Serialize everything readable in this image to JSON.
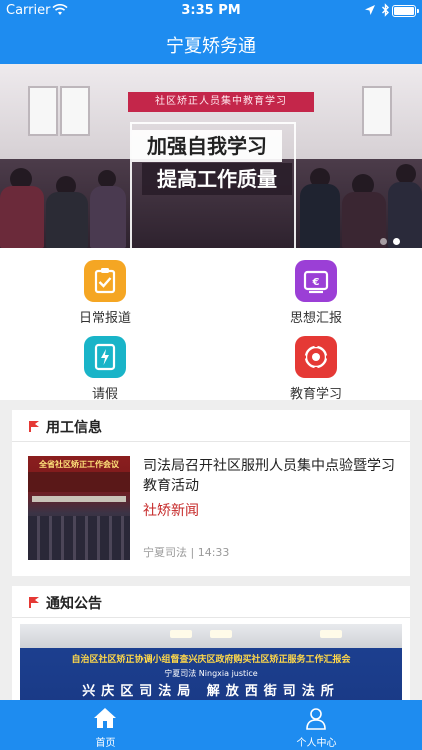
{
  "status": {
    "carrier": "Carrier",
    "time": "3:35 PM"
  },
  "nav": {
    "title": "宁夏矫务通"
  },
  "banner": {
    "wall_text": "社区矫正人员集中教育学习",
    "line1": "加强自我学习",
    "line2": "提高工作质量",
    "page_count": 2,
    "active_page": 2
  },
  "menu": {
    "items": [
      {
        "label": "日常报道",
        "icon": "clipboard-check-icon",
        "color": "#f5a623"
      },
      {
        "label": "思想汇报",
        "icon": "report-icon",
        "color": "#9b3fd6"
      },
      {
        "label": "请假",
        "icon": "leave-tablet-icon",
        "color": "#19b4c8"
      },
      {
        "label": "教育学习",
        "icon": "target-icon",
        "color": "#e53935"
      }
    ]
  },
  "sections": {
    "employment": {
      "title": "用工信息",
      "item": {
        "thumb_caption": "全省社区矫正工作会议",
        "title": "司法局召开社区服刑人员集中点验暨学习教育活动",
        "tag": "社矫新闻",
        "source": "宁夏司法",
        "time": "14:33"
      }
    },
    "notice": {
      "title": "通知公告",
      "image_text_1": "自治区社区矫正协调小组督查兴庆区政府购买社区矫正服务工作汇报会",
      "image_text_2": "宁夏司法  Ningxia justice",
      "image_text_3": "兴庆区司法局 解放西街司法所"
    }
  },
  "tabbar": {
    "items": [
      {
        "label": "首页",
        "icon": "home-icon"
      },
      {
        "label": "个人中心",
        "icon": "user-icon"
      }
    ]
  },
  "colors": {
    "primary": "#1e8cf0",
    "accent_red": "#c62828"
  }
}
